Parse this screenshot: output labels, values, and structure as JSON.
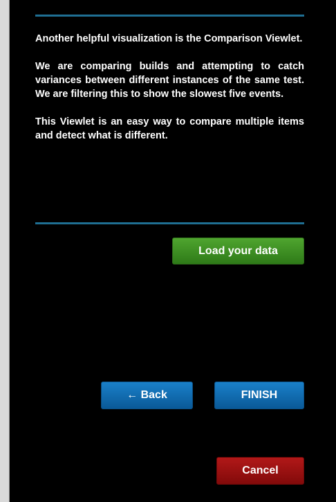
{
  "content": {
    "paragraphs": [
      "Another helpful visualization is the Comparison Viewlet.",
      "We are comparing builds and attempting to catch variances between different instances of the same test. We are filtering this to show the slowest five events.",
      "This Viewlet is an easy way to compare multiple items and detect what is different."
    ]
  },
  "buttons": {
    "load_data": "Load your data",
    "back": "← Back",
    "finish": "FINISH",
    "cancel": "Cancel"
  },
  "colors": {
    "background": "#000000",
    "divider": "#1f6f93",
    "primary": "#0a5a98",
    "success": "#2e7a18",
    "danger": "#820a0a"
  }
}
